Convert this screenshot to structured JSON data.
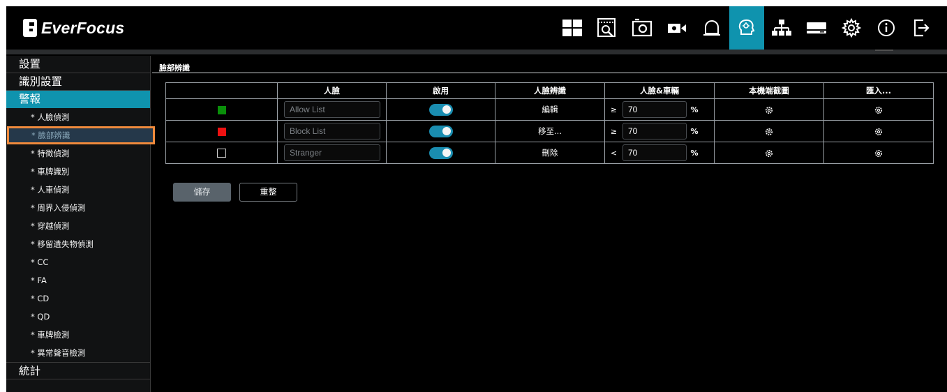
{
  "header": {
    "brand": "EverFocus",
    "icons": [
      {
        "name": "layout-grid-icon",
        "active": false
      },
      {
        "name": "playback-search-icon",
        "active": false
      },
      {
        "name": "snapshot-camera-icon",
        "active": false
      },
      {
        "name": "video-camera-icon",
        "active": false
      },
      {
        "name": "alarm-bell-icon",
        "active": false
      },
      {
        "name": "ai-head-icon",
        "active": true
      },
      {
        "name": "network-icon",
        "active": false
      },
      {
        "name": "storage-drive-icon",
        "active": false
      },
      {
        "name": "settings-gear-icon",
        "active": false
      },
      {
        "name": "info-icon",
        "active": false
      },
      {
        "name": "logout-icon",
        "active": false
      }
    ]
  },
  "sidebar": {
    "categories": [
      "設置",
      "識別設置",
      "警報",
      "統計"
    ],
    "items": [
      "* 人臉偵測",
      "* 臉部辨識",
      "* 特徵偵測",
      "* 車牌識別",
      "* 人車偵測",
      "* 周界入侵偵測",
      "* 穿越偵測",
      "* 移留遺失物偵測",
      "* CC",
      "* FA",
      "* CD",
      "* QD",
      "* 車牌檢測",
      "* 異常聲音檢測"
    ]
  },
  "main": {
    "title": "臉部辨識",
    "table": {
      "headers": [
        "",
        "人臉",
        "啟用",
        "人臉辨識",
        "人臉&車輛",
        "本機端截圖",
        "匯入..."
      ],
      "rows": [
        {
          "color": "#0a8f0a",
          "name": "Allow List",
          "enabled": true,
          "action": "編輯",
          "op": "≥",
          "threshold": "70",
          "unit": "%"
        },
        {
          "color": "#ee1111",
          "name": "Block List",
          "enabled": true,
          "action": "移至...",
          "op": "≥",
          "threshold": "70",
          "unit": "%"
        },
        {
          "color": "none",
          "name": "Stranger",
          "enabled": true,
          "action": "刪除",
          "op": "<",
          "threshold": "70",
          "unit": "%"
        }
      ]
    },
    "buttons": {
      "save": "儲存",
      "reset": "重整"
    }
  },
  "colors": {
    "accent": "#0f93ae",
    "selection_outline": "#ef8a3c",
    "toggle_on": "#1a8db0"
  }
}
